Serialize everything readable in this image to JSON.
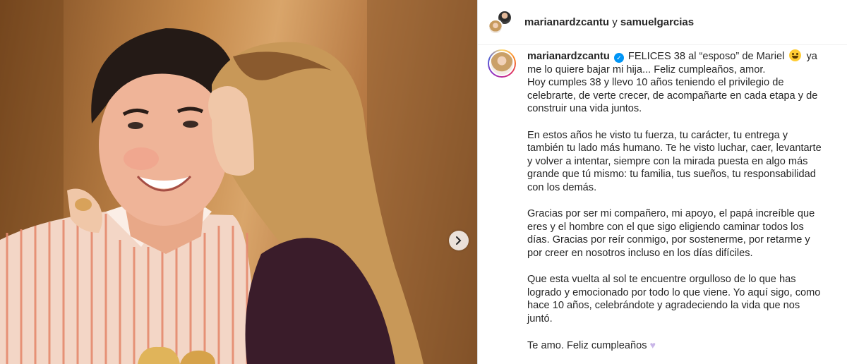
{
  "post": {
    "header": {
      "author": "marianardzcantu",
      "connector": "y",
      "coauthor": "samuelgarcias"
    },
    "caption": {
      "author": "marianardzcantu",
      "lines": [
        "FELICES 38 al “esposo” de Mariel",
        "ya me lo quiere bajar mi hija... Feliz cumpleaños, amor.",
        "Hoy cumples 38 y llevo 10 años teniendo el privilegio de celebrarte, de verte crecer, de acompañarte en cada etapa y de construir una vida juntos.",
        "En estos años he visto tu fuerza, tu carácter, tu entrega y también tu lado más humano. Te he visto luchar, caer, levantarte y volver a intentar, siempre con la mirada puesta en algo más grande que tú mismo: tu familia, tus sueños, tu responsabilidad con los demás.",
        "Gracias por ser mi compañero, mi apoyo, el papá increíble que eres y el hombre con el que sigo eligiendo caminar todos los días. Gracias por reír conmigo, por sostenerme, por retarme y por creer en nosotros incluso en los días difíciles.",
        "Que esta vuelta al sol te encuentre orgulloso de lo que has logrado y emocionado por todo lo que viene. Yo aquí sigo, como hace 10 años, celebrándote y agradeciendo la vida que nos juntó.",
        "Te amo. Feliz cumpleaños"
      ]
    },
    "icons": {
      "verified": "verified-badge-icon",
      "emoji_1": "grinning-emoji-icon",
      "emoji_2": "purple-heart-icon",
      "carousel_next": "chevron-right-icon"
    },
    "colors": {
      "verified": "#0095f6",
      "text": "#262626",
      "border": "#dbdbdb"
    }
  }
}
